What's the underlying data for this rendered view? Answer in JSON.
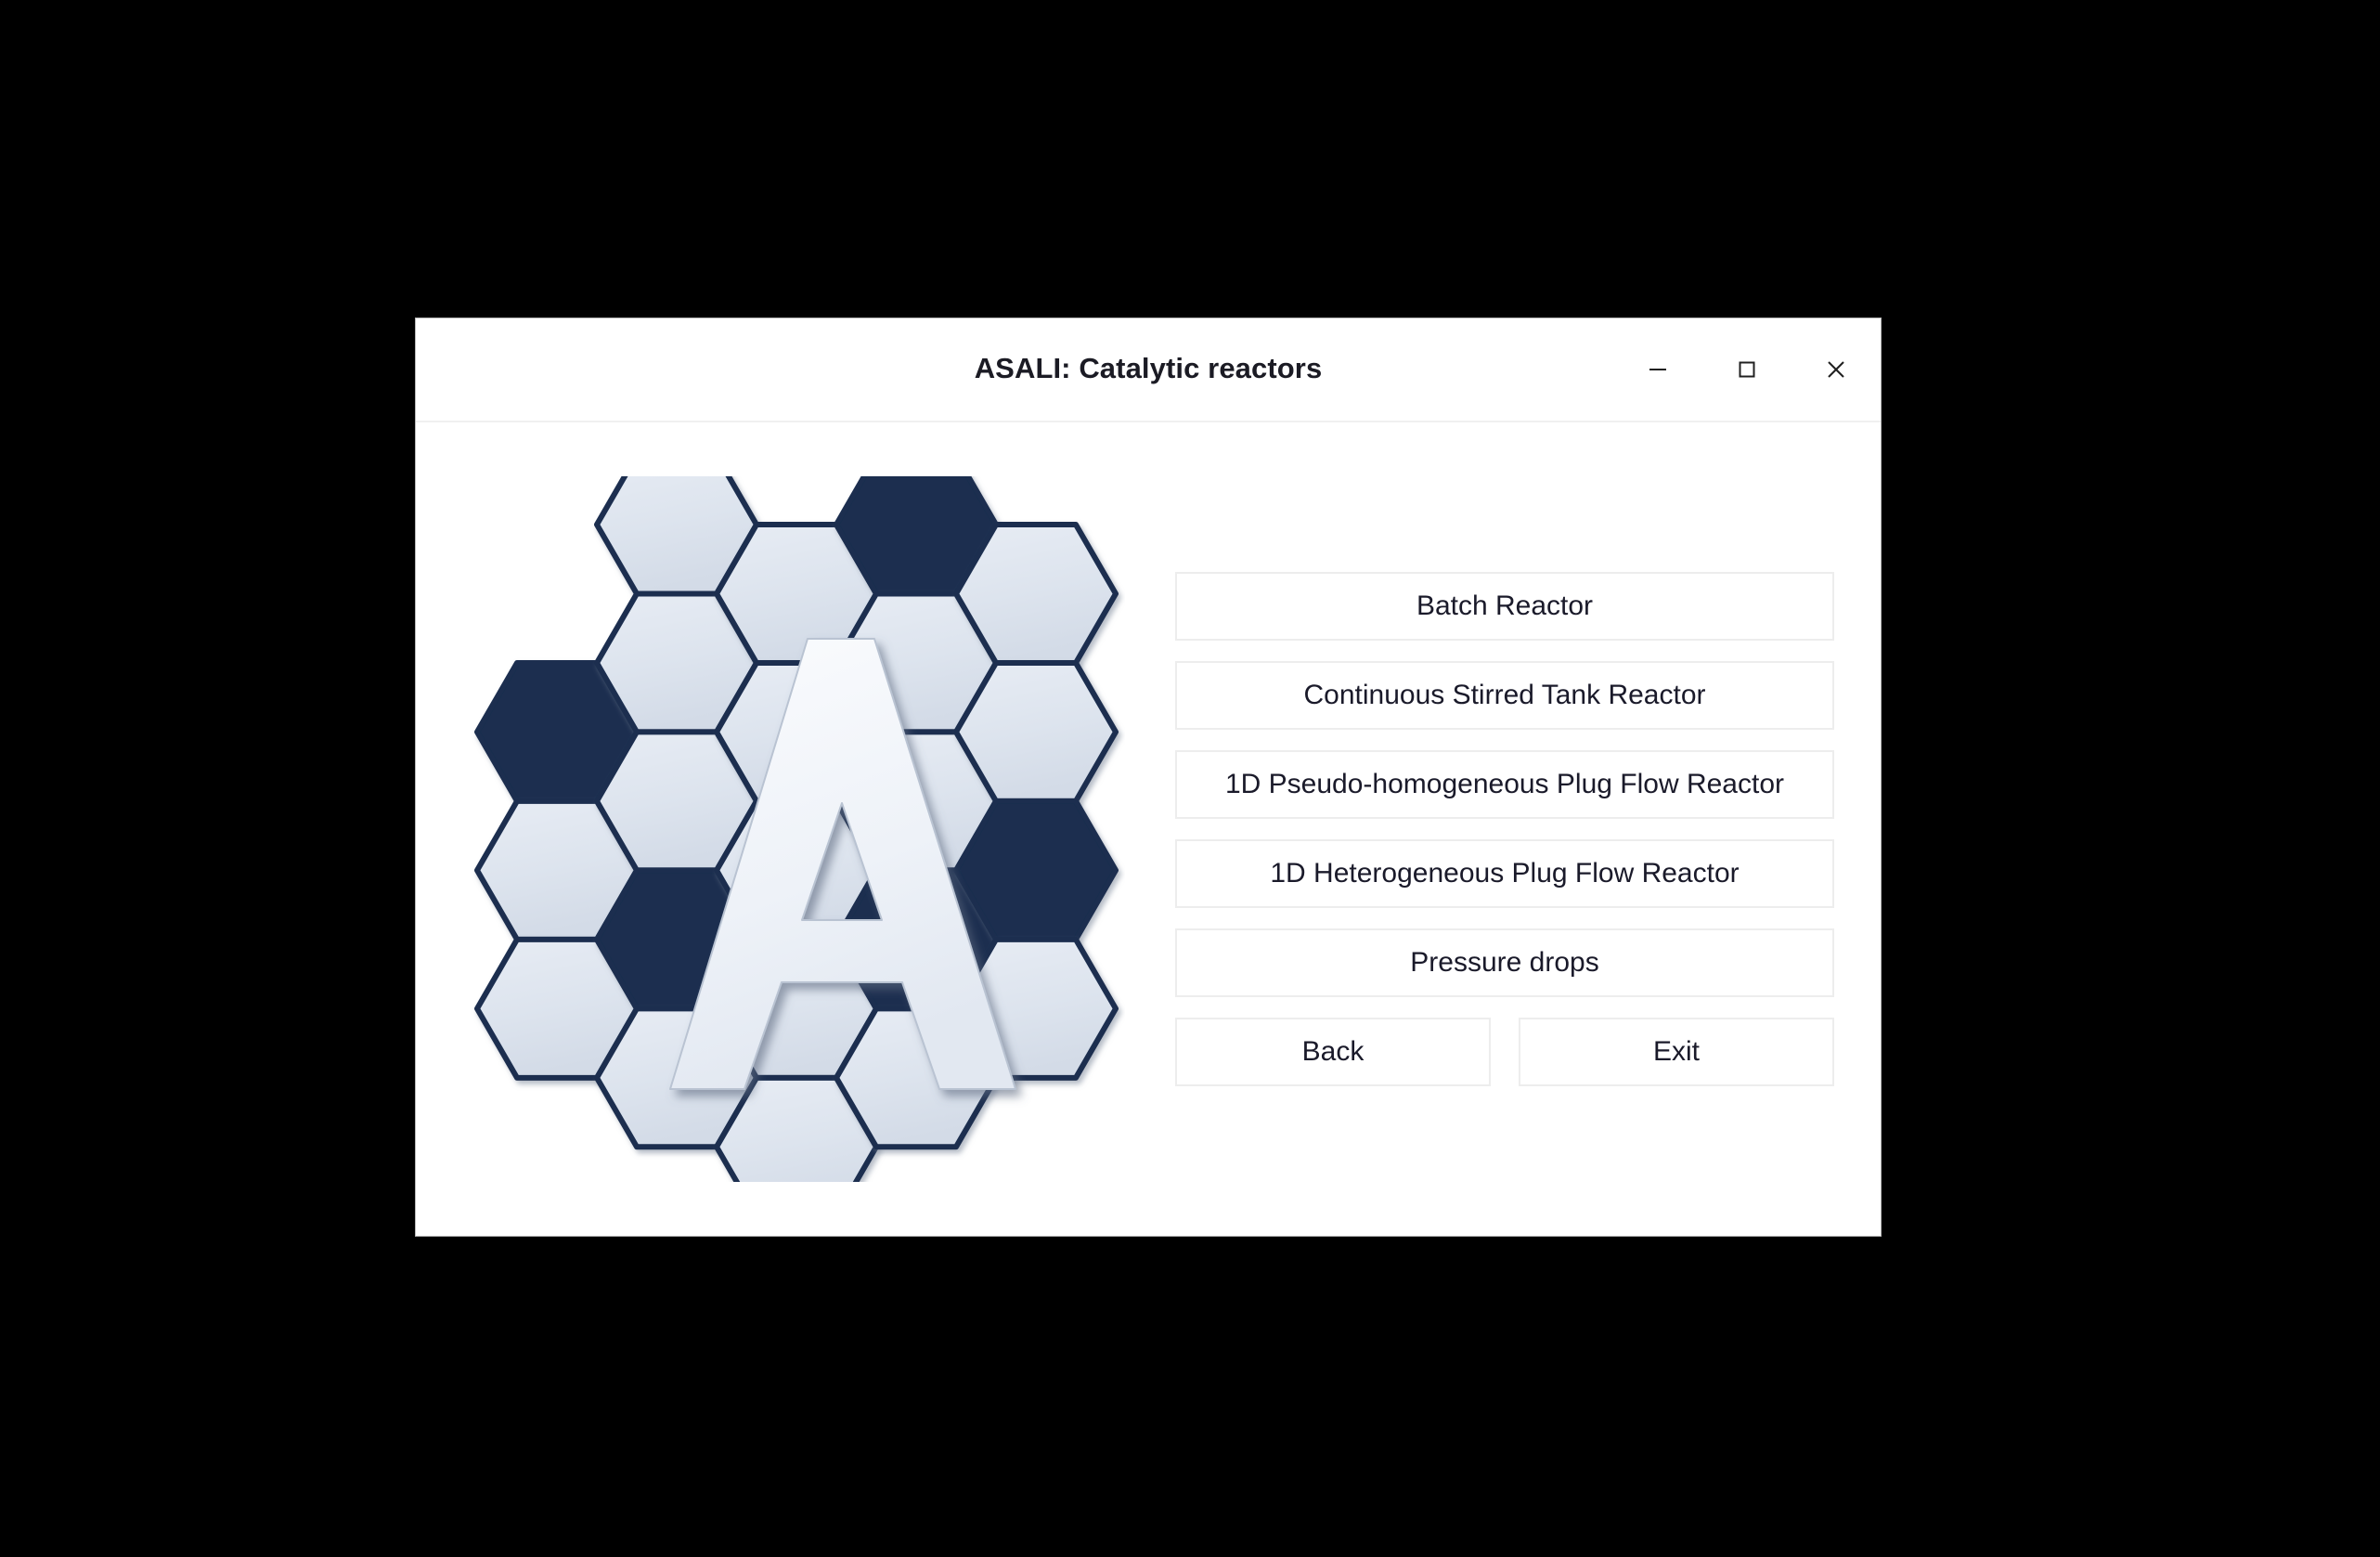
{
  "window": {
    "title": "ASALI: Catalytic reactors",
    "controls": {
      "minimize": "minimize-icon",
      "maximize": "maximize-icon",
      "close": "close-icon"
    }
  },
  "logo": {
    "letter": "A",
    "alt": "ASALI hexagon honeycomb logo",
    "colors": {
      "dark": "#1a2e4f",
      "light": "#dde4ee",
      "letter": "#eef2f8",
      "outline": "#1a2e4f"
    },
    "hexagons": [
      {
        "col": 1,
        "row": 1,
        "fill": "dark"
      },
      {
        "col": 1,
        "row": 2,
        "fill": "light"
      },
      {
        "col": 1,
        "row": 3,
        "fill": "light"
      },
      {
        "col": 2,
        "row": 0,
        "fill": "light"
      },
      {
        "col": 2,
        "row": 1,
        "fill": "light"
      },
      {
        "col": 2,
        "row": 2,
        "fill": "light"
      },
      {
        "col": 2,
        "row": 3,
        "fill": "dark"
      },
      {
        "col": 2,
        "row": 4,
        "fill": "light"
      },
      {
        "col": 3,
        "row": 0,
        "fill": "light"
      },
      {
        "col": 3,
        "row": 1,
        "fill": "light"
      },
      {
        "col": 3,
        "row": 2,
        "fill": "light"
      },
      {
        "col": 3,
        "row": 3,
        "fill": "light"
      },
      {
        "col": 3,
        "row": 4,
        "fill": "light"
      },
      {
        "col": 4,
        "row": 0,
        "fill": "dark"
      },
      {
        "col": 4,
        "row": 1,
        "fill": "light"
      },
      {
        "col": 4,
        "row": 2,
        "fill": "light"
      },
      {
        "col": 4,
        "row": 3,
        "fill": "dark"
      },
      {
        "col": 4,
        "row": 4,
        "fill": "light"
      },
      {
        "col": 5,
        "row": 0,
        "fill": "light"
      },
      {
        "col": 5,
        "row": 1,
        "fill": "light"
      },
      {
        "col": 5,
        "row": 2,
        "fill": "dark"
      },
      {
        "col": 5,
        "row": 3,
        "fill": "light"
      }
    ]
  },
  "menu": {
    "buttons": [
      {
        "id": "batch-reactor",
        "label": "Batch Reactor"
      },
      {
        "id": "cstr",
        "label": "Continuous Stirred Tank Reactor"
      },
      {
        "id": "pseudo-homogeneous-pfr",
        "label": "1D Pseudo-homogeneous Plug Flow Reactor"
      },
      {
        "id": "heterogeneous-pfr",
        "label": "1D Heterogeneous Plug Flow Reactor"
      },
      {
        "id": "pressure-drops",
        "label": "Pressure drops"
      }
    ],
    "footer": [
      {
        "id": "back",
        "label": "Back"
      },
      {
        "id": "exit",
        "label": "Exit"
      }
    ]
  }
}
